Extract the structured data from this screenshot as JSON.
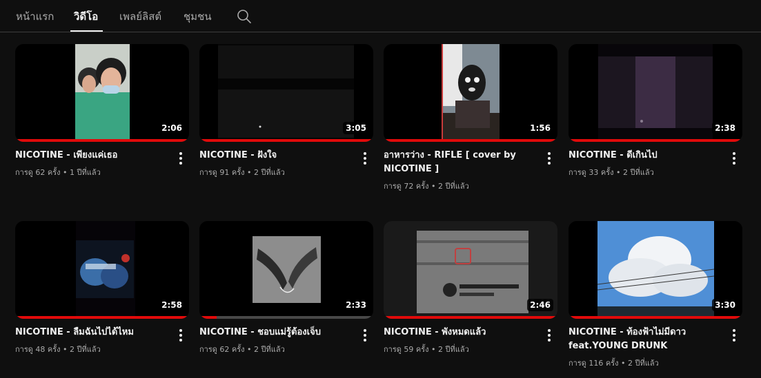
{
  "tabs": [
    {
      "label": "หน้าแรก"
    },
    {
      "label": "วิดีโอ"
    },
    {
      "label": "เพลย์ลิสต์"
    },
    {
      "label": "ชุมชน"
    }
  ],
  "search": {
    "icon": "search-icon"
  },
  "accent_color": "#e10a0a",
  "videos": [
    {
      "title": "NICOTINE - เพียงแค่เธอ",
      "views": "การดู 62 ครั้ง",
      "age": "1 ปีที่แล้ว",
      "duration": "2:06",
      "progress": 1.0
    },
    {
      "title": "NICOTINE - ฝังใจ",
      "views": "การดู 91 ครั้ง",
      "age": "2 ปีที่แล้ว",
      "duration": "3:05",
      "progress": 1.0
    },
    {
      "title": "อาหารว่าง - RIFLE [ cover by NICOTINE ]",
      "views": "การดู 72 ครั้ง",
      "age": "2 ปีที่แล้ว",
      "duration": "1:56",
      "progress": 1.0
    },
    {
      "title": "NICOTINE - ดีเกินไป",
      "views": "การดู 33 ครั้ง",
      "age": "2 ปีที่แล้ว",
      "duration": "2:38",
      "progress": 1.0
    },
    {
      "title": "NICOTINE - ลืมฉันไปได้ไหม",
      "views": "การดู 48 ครั้ง",
      "age": "2 ปีที่แล้ว",
      "duration": "2:58",
      "progress": 1.0
    },
    {
      "title": "NICOTINE - ชอบแม่รู้ต้องเจ็บ",
      "views": "การดู 62 ครั้ง",
      "age": "2 ปีที่แล้ว",
      "duration": "2:33",
      "progress": 0.1
    },
    {
      "title": "NICOTINE - พังหมดแล้ว",
      "views": "การดู 59 ครั้ง",
      "age": "2 ปีที่แล้ว",
      "duration": "2:46",
      "progress": 1.0
    },
    {
      "title": "NICOTINE - ท้องฟ้าไม่มีดาว feat.YOUNG DRUNK",
      "views": "การดู 116 ครั้ง",
      "age": "2 ปีที่แล้ว",
      "duration": "3:30",
      "progress": 1.0
    }
  ]
}
